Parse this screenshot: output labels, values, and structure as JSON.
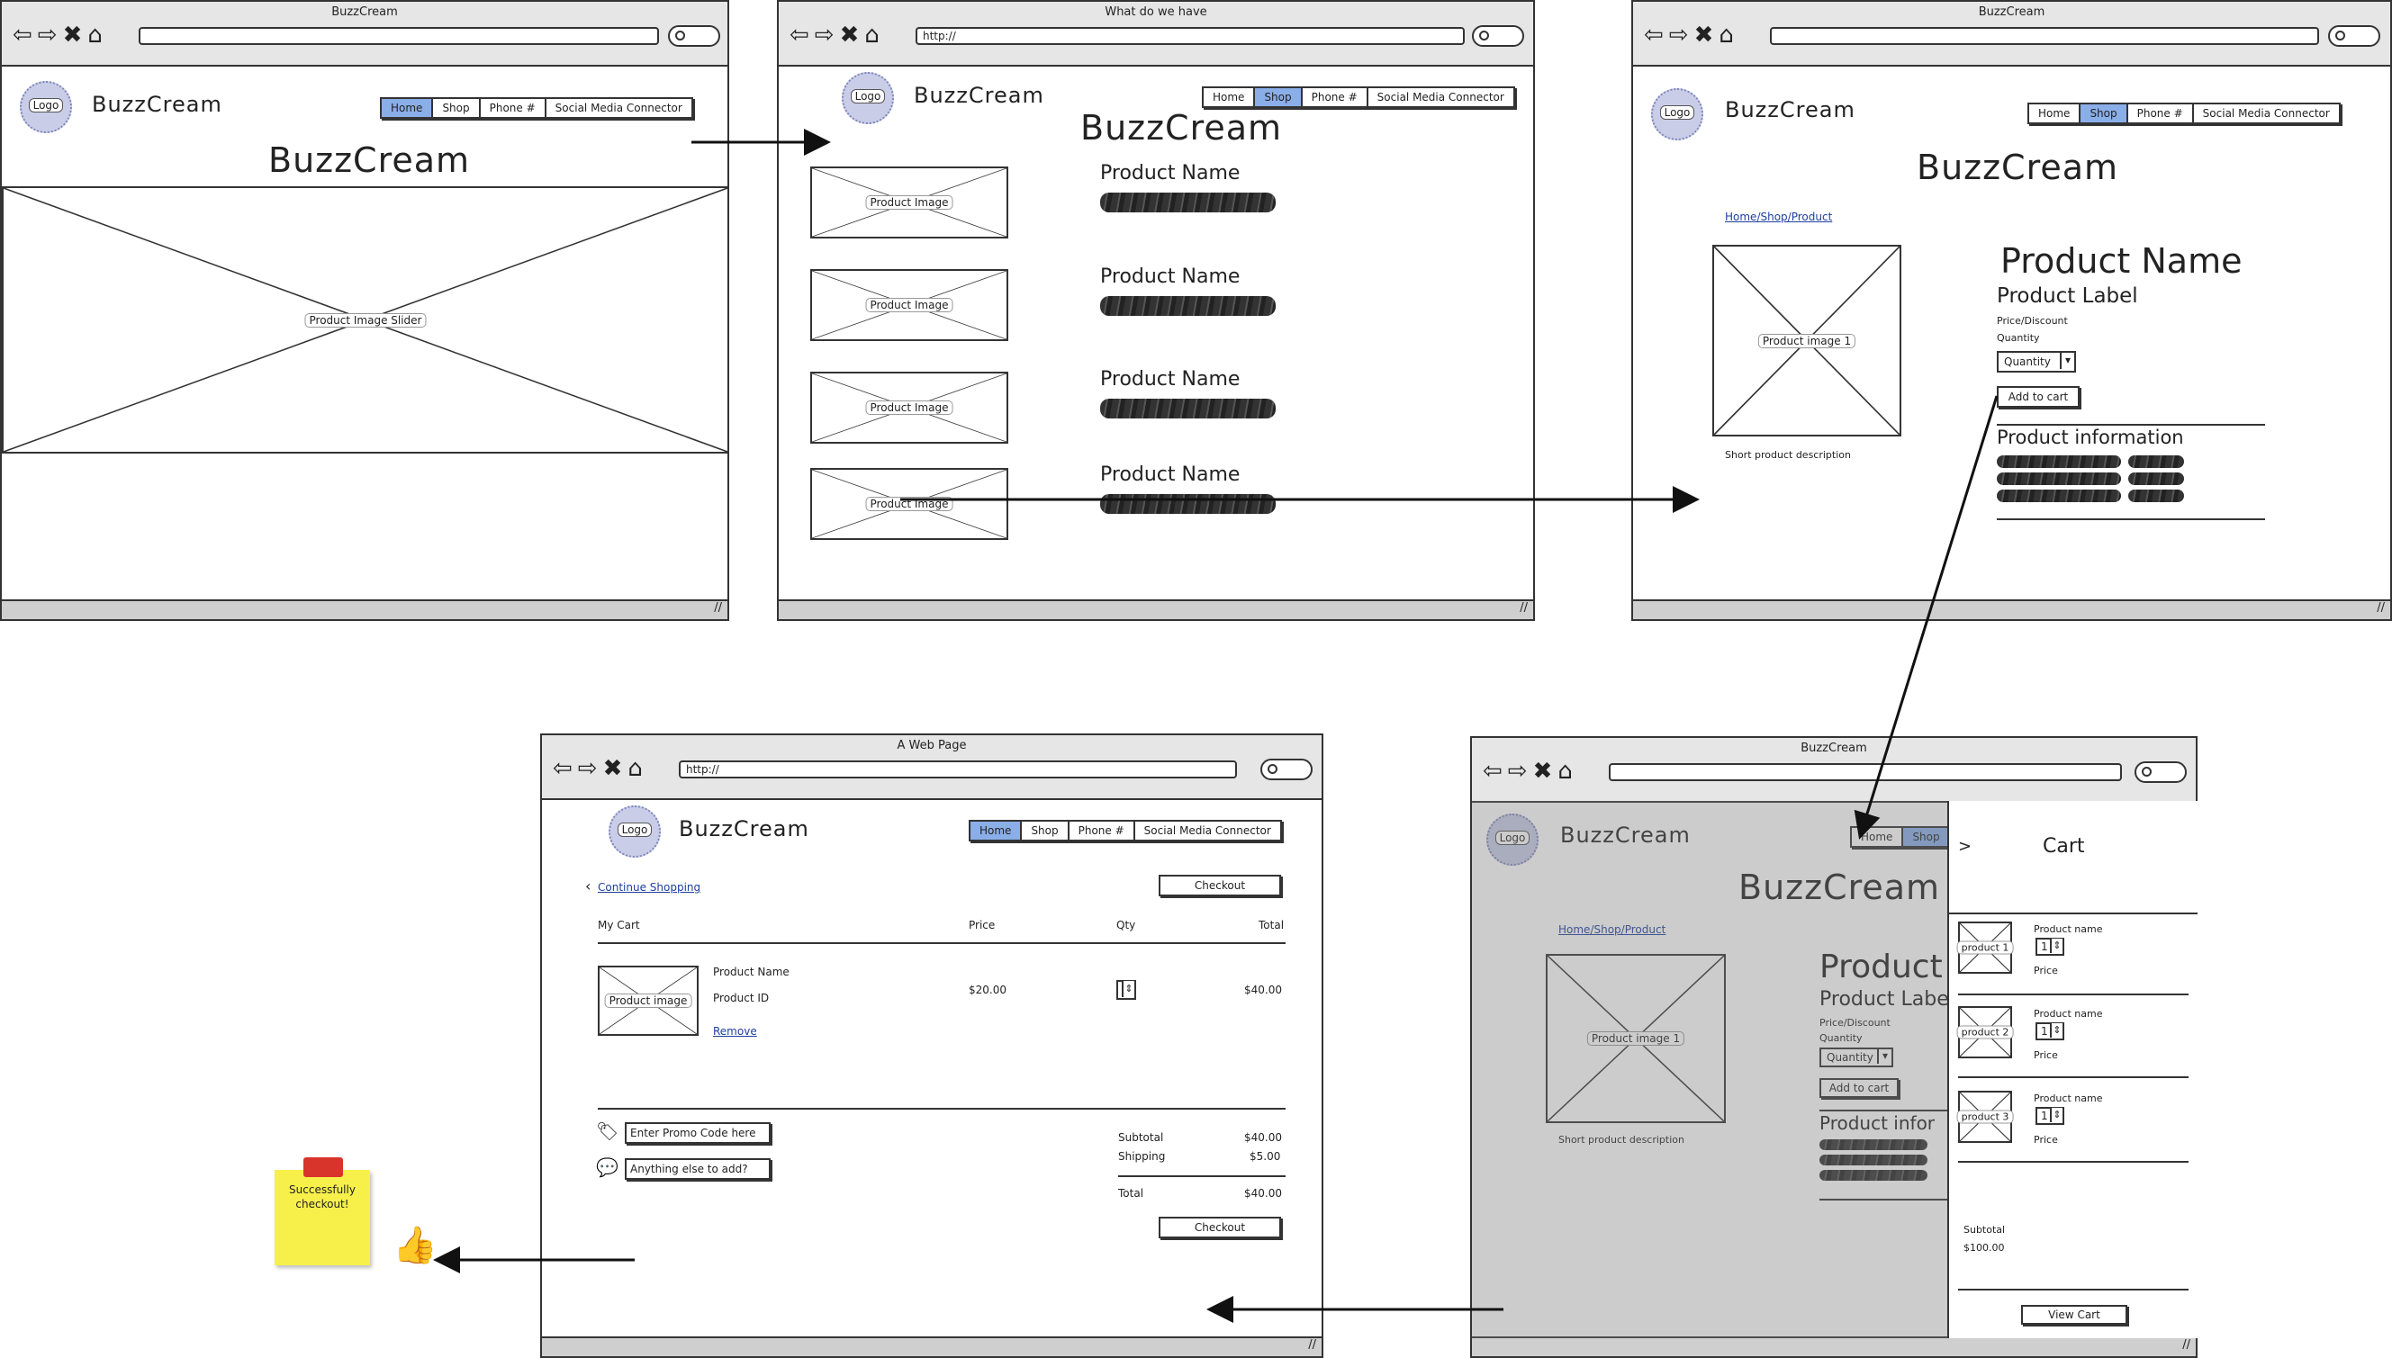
{
  "brand": "BuzzCream",
  "logo_label": "Logo",
  "nav_tabs": [
    "Home",
    "Shop",
    "Phone #",
    "Social Media Connector"
  ],
  "window1": {
    "title": "BuzzCream",
    "heading": "BuzzCream",
    "slider_label": "Product Image Slider"
  },
  "window2": {
    "title": "What do we have",
    "url": "http://",
    "heading": "BuzzCream",
    "image_label": "Product Image",
    "product_name": "Product Name"
  },
  "window3": {
    "title": "BuzzCream",
    "heading": "BuzzCream",
    "breadcrumb": "Home/Shop/Product",
    "image_label": "Product image 1",
    "short_desc": "Short product description",
    "product_name": "Product Name",
    "product_label": "Product Label",
    "price": "Price/Discount",
    "qty_label": "Quantity",
    "qty_select": "Quantity",
    "add_to_cart": "Add to cart",
    "info_heading": "Product information"
  },
  "window4": {
    "title": "BuzzCream",
    "heading": "BuzzCream",
    "breadcrumb": "Home/Shop/Product",
    "image_label": "Product image 1",
    "short_desc": "Short product description",
    "product_name": "Product",
    "product_label": "Product Labe",
    "price": "Price/Discount",
    "qty_label": "Quantity",
    "qty_select": "Quantity",
    "add_to_cart": "Add to cart",
    "info_heading": "Product infor",
    "tab_home": "Home",
    "tab_shop": "Shop",
    "cart": {
      "back": ">",
      "title": "Cart",
      "items": [
        {
          "img": "product 1",
          "name": "Product name",
          "qty": "1",
          "price": "Price"
        },
        {
          "img": "product 2",
          "name": "Product name",
          "qty": "1",
          "price": "Price"
        },
        {
          "img": "product 3",
          "name": "Product name",
          "qty": "1",
          "price": "Price"
        }
      ],
      "subtotal_label": "Subtotal",
      "subtotal": "$100.00",
      "view_cart": "View Cart"
    }
  },
  "window5": {
    "title": "A Web Page",
    "url": "http://",
    "continue": "Continue Shopping",
    "checkout": "Checkout",
    "columns": {
      "cart": "My Cart",
      "price": "Price",
      "qty": "Qty",
      "total": "Total"
    },
    "item": {
      "image": "Product image",
      "name": "Product Name",
      "id": "Product ID",
      "remove": "Remove",
      "price": "$20.00",
      "qty": "2",
      "total": "$40.00"
    },
    "promo": "Enter Promo Code here",
    "note": "Anything else to add?",
    "subtotal_label": "Subtotal",
    "subtotal": "$40.00",
    "shipping_label": "Shipping",
    "shipping": "$5.00",
    "total_label": "Total",
    "total": "$40.00"
  },
  "sticky_note": "Successfully checkout!",
  "colors": {
    "active_tab": "#8aaee8",
    "link": "#1e3f9e",
    "sticky": "#f7f04a",
    "pin": "#d9342b",
    "overlay": "#9a9a9a"
  }
}
